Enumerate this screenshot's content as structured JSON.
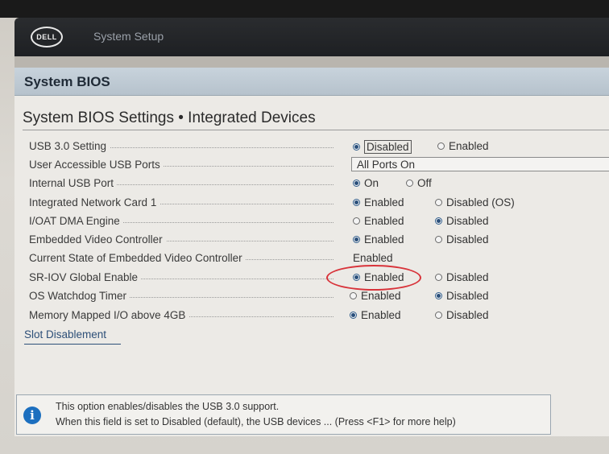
{
  "header": {
    "logo": "DELL",
    "app_title": "System Setup"
  },
  "section": {
    "title": "System BIOS"
  },
  "page": {
    "title": "System BIOS Settings • Integrated Devices"
  },
  "settings": [
    {
      "label": "USB 3.0 Setting",
      "options": [
        "Disabled",
        "Enabled"
      ],
      "selected": 0
    },
    {
      "label": "User Accessible USB Ports",
      "value": "All Ports On"
    },
    {
      "label": "Internal USB Port",
      "options": [
        "On",
        "Off"
      ],
      "selected": 0
    },
    {
      "label": "Integrated Network Card 1",
      "options": [
        "Enabled",
        "Disabled (OS)"
      ],
      "selected": 0
    },
    {
      "label": "I/OAT DMA Engine",
      "options": [
        "Enabled",
        "Disabled"
      ],
      "selected": 1
    },
    {
      "label": "Embedded Video Controller",
      "options": [
        "Enabled",
        "Disabled"
      ],
      "selected": 0
    },
    {
      "label": "Current State of Embedded Video Controller",
      "value": "Enabled"
    },
    {
      "label": "SR-IOV Global Enable",
      "options": [
        "Enabled",
        "Disabled"
      ],
      "selected": 0
    },
    {
      "label": "OS Watchdog Timer",
      "options": [
        "Enabled",
        "Disabled"
      ],
      "selected": 1
    },
    {
      "label": "Memory Mapped I/O above 4GB",
      "options": [
        "Enabled",
        "Disabled"
      ],
      "selected": 0
    }
  ],
  "slot_link": "Slot Disablement",
  "help": {
    "icon": "info-icon",
    "line1": "This option enables/disables the USB 3.0 support.",
    "line2": "When this field is set to Disabled (default), the USB devices ... (Press <F1> for more help)"
  },
  "colors": {
    "header": "#1e2023",
    "section_bar": "#b6c2cc",
    "highlight": "#d8333a",
    "radio": "#2a4f7a"
  }
}
